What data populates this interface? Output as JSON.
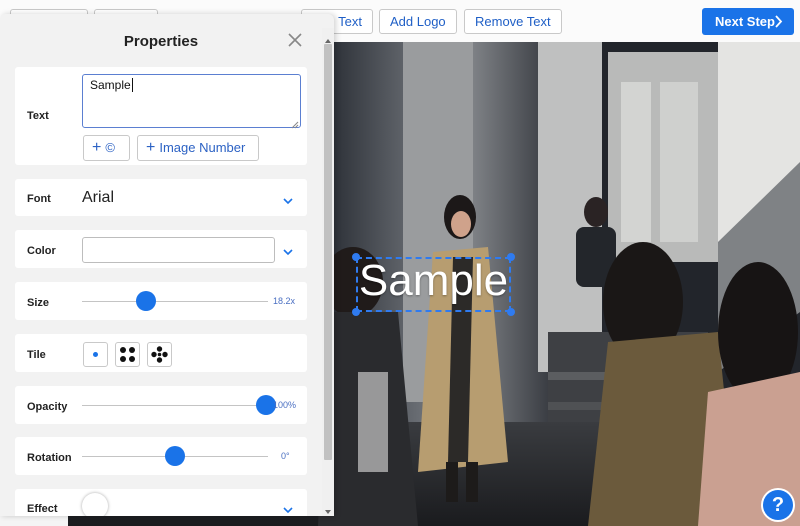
{
  "toolbar": {
    "add_text": "Text",
    "add_logo": "Add Logo",
    "remove_text": "Remove Text",
    "next_step": "Next Step",
    "next_icon": "chevron-right-icon"
  },
  "watermark": {
    "text": "Sample",
    "color": "#ffffff",
    "selection_color": "#2f7bf0"
  },
  "panel": {
    "title": "Properties",
    "close_icon": "close-icon",
    "text": {
      "label": "Text",
      "value": "Sample",
      "copyright_button": "©",
      "image_number_button": "Image Number"
    },
    "font": {
      "label": "Font",
      "value": "Arial"
    },
    "color": {
      "label": "Color",
      "value": ""
    },
    "size": {
      "label": "Size",
      "value": "18.2x",
      "level": 0.34
    },
    "tile": {
      "label": "Tile",
      "options": [
        "single-dot-icon",
        "four-dots-icon",
        "five-dots-icon"
      ],
      "selected": 0
    },
    "opacity": {
      "label": "Opacity",
      "value": "100%",
      "level": 1.0
    },
    "rotation": {
      "label": "Rotation",
      "value": "0°",
      "level": 0.5
    },
    "effect": {
      "label": "Effect"
    }
  },
  "help": {
    "label": "?"
  },
  "accent_color": "#1a73e8"
}
